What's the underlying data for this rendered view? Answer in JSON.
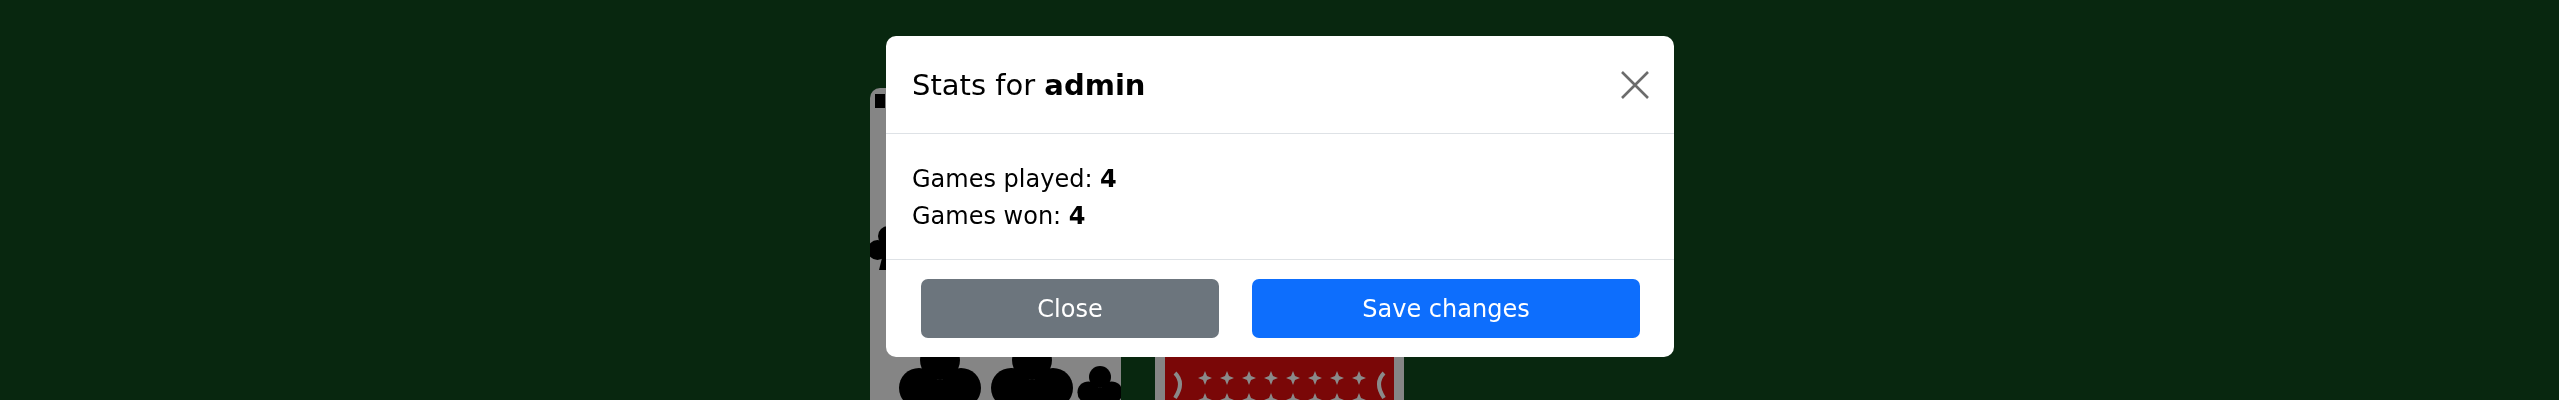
{
  "table": {
    "cards": [
      {
        "kind": "face"
      },
      {
        "kind": "back"
      }
    ]
  },
  "dialog": {
    "title": "Stats for **admin**",
    "stats": [
      "Games played: **4**",
      "Games won: **4**"
    ],
    "buttons": [
      {
        "label": "Close",
        "kind": "secondary"
      },
      {
        "label": "Save changes",
        "kind": "primary"
      }
    ]
  }
}
